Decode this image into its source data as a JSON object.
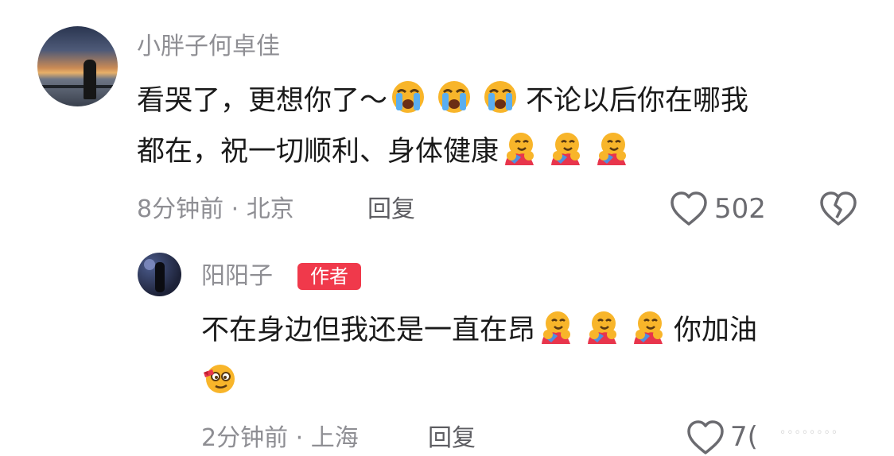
{
  "comment": {
    "username": "小胖子何卓佳",
    "text_line1_a": "看哭了，更想你了～",
    "text_line1_b": "不论以后你在哪我",
    "text_line2": "都在，祝一切顺利、身体健康",
    "meta": "8分钟前 · 北京",
    "reply_label": "回复",
    "like_count": "502"
  },
  "reply": {
    "username": "阳阳子",
    "badge": "作者",
    "text_line1_a": "不在身边但我还是一直在昂",
    "text_line1_b": "你加油",
    "meta": "2分钟前 · 上海",
    "reply_label": "回复",
    "like_count": "7("
  },
  "icons": [
    "loudly-crying-face-emoji",
    "hugging-face-emoji",
    "zany-face-emoji",
    "heart-outline-icon",
    "broken-heart-icon"
  ]
}
